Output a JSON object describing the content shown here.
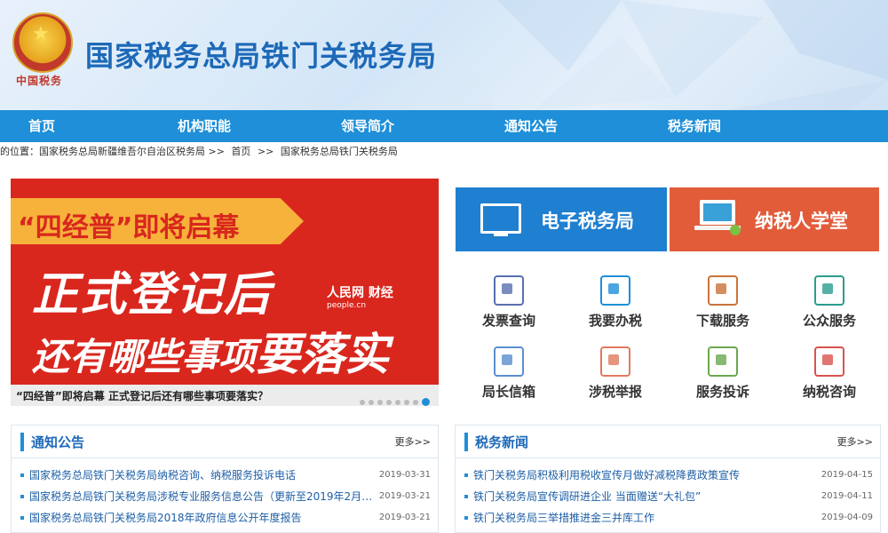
{
  "header": {
    "site_title": "国家税务总局铁门关税务局",
    "emblem_text": "中国税务"
  },
  "nav": [
    "首页",
    "机构职能",
    "领导简介",
    "通知公告",
    "税务新闻"
  ],
  "breadcrumb": [
    "的位置：国家税务总局新疆维吾尔自治区税务局 >>",
    "首页",
    ">>",
    "国家税务总局铁门关税务局"
  ],
  "banner": {
    "top_text": "“四经普”即将启幕",
    "line1": "正式登记后",
    "line2_a": "还有哪些事项",
    "line2_b": "要落实",
    "logo": "人民网 财经",
    "logo_sub": "people.cn",
    "caption": "“四经普”即将启幕 正式登记后还有哪些事项要落实？",
    "slide_count": 8,
    "active_slide": 7
  },
  "services": {
    "etax": "电子税务局",
    "school": "纳税人学堂"
  },
  "grid": [
    {
      "label": "发票查询",
      "icon": "invoice-icon",
      "color": "#5a6fb0"
    },
    {
      "label": "我要办税",
      "icon": "notebook-icon",
      "color": "#1e8fd8"
    },
    {
      "label": "下载服务",
      "icon": "download-icon",
      "color": "#c8733a"
    },
    {
      "label": "公众服务",
      "icon": "public-service-icon",
      "color": "#2a9d8f"
    },
    {
      "label": "局长信箱",
      "icon": "chat-icon",
      "color": "#5a8fd0"
    },
    {
      "label": "涉税举报",
      "icon": "report-icon",
      "color": "#e07a5f"
    },
    {
      "label": "服务投诉",
      "icon": "edit-icon",
      "color": "#6aa84f"
    },
    {
      "label": "纳税咨询",
      "icon": "phone-icon",
      "color": "#d9534f"
    }
  ],
  "notices": {
    "title": "通知公告",
    "more": "更多>>",
    "items": [
      {
        "text": "国家税务总局铁门关税务局纳税咨询、纳税服务投诉电话",
        "date": "2019-03-31"
      },
      {
        "text": "国家税务总局铁门关税务局涉税专业服务信息公告（更新至2019年2月1...",
        "date": "2019-03-21"
      },
      {
        "text": "国家税务总局铁门关税务局2018年政府信息公开年度报告",
        "date": "2019-03-21"
      }
    ]
  },
  "news": {
    "title": "税务新闻",
    "more": "更多>>",
    "items": [
      {
        "text": "铁门关税务局积极利用税收宣传月做好减税降费政策宣传",
        "date": "2019-04-15"
      },
      {
        "text": "铁门关税务局宣传调研进企业 当面赠送“大礼包”",
        "date": "2019-04-11"
      },
      {
        "text": "铁门关税务局三举措推进金三并库工作",
        "date": "2019-04-09"
      }
    ]
  }
}
